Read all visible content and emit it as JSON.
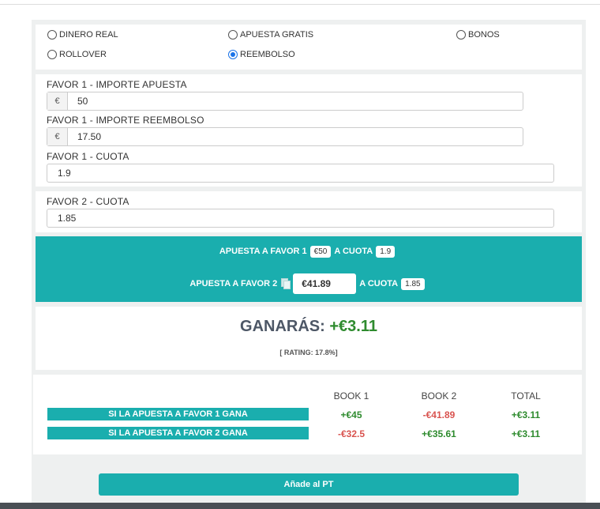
{
  "bet_types": [
    {
      "label": "DINERO REAL",
      "selected": false
    },
    {
      "label": "APUESTA GRATIS",
      "selected": false
    },
    {
      "label": "BONOS",
      "selected": false
    },
    {
      "label": "ROLLOVER",
      "selected": false
    },
    {
      "label": "REEMBOLSO",
      "selected": true
    }
  ],
  "favor1": {
    "stake_label": "FAVOR 1 - IMPORTE APUESTA",
    "stake_currency": "€",
    "stake_value": "50",
    "refund_label": "FAVOR 1 - IMPORTE REEMBOLSO",
    "refund_currency": "€",
    "refund_value": "17.50",
    "odds_label": "FAVOR 1 - CUOTA",
    "odds_value": "1.9"
  },
  "favor2": {
    "odds_label": "FAVOR 2 - CUOTA",
    "odds_value": "1.85"
  },
  "summary": {
    "bet1_text": "APUESTA A FAVOR 1",
    "bet1_stake": "€50",
    "odds_text": "A CUOTA",
    "bet1_odds": "1.9",
    "bet2_text": "APUESTA A FAVOR 2",
    "bet2_stake": "€41.89",
    "bet2_odds": "1.85"
  },
  "result": {
    "win_label": "GANARÁS:",
    "win_amount": "+€3.11",
    "rating": "[ RATING: 17.8%]"
  },
  "table": {
    "headers": [
      "BOOK 1",
      "BOOK 2",
      "TOTAL"
    ],
    "rows": [
      {
        "label": "SI LA APUESTA A FAVOR 1 GANA",
        "book1": "+€45",
        "book2": "-€41.89",
        "total": "+€3.11"
      },
      {
        "label": "SI LA APUESTA A FAVOR 2 GANA",
        "book1": "-€32.5",
        "book2": "+€35.61",
        "total": "+€3.11"
      }
    ]
  },
  "add_button": "Añade al PT",
  "colors": {
    "accent": "#1aaeae",
    "positive": "#2e8b2e",
    "negative": "#d9534f",
    "radio_selected": "#1a73e8"
  }
}
